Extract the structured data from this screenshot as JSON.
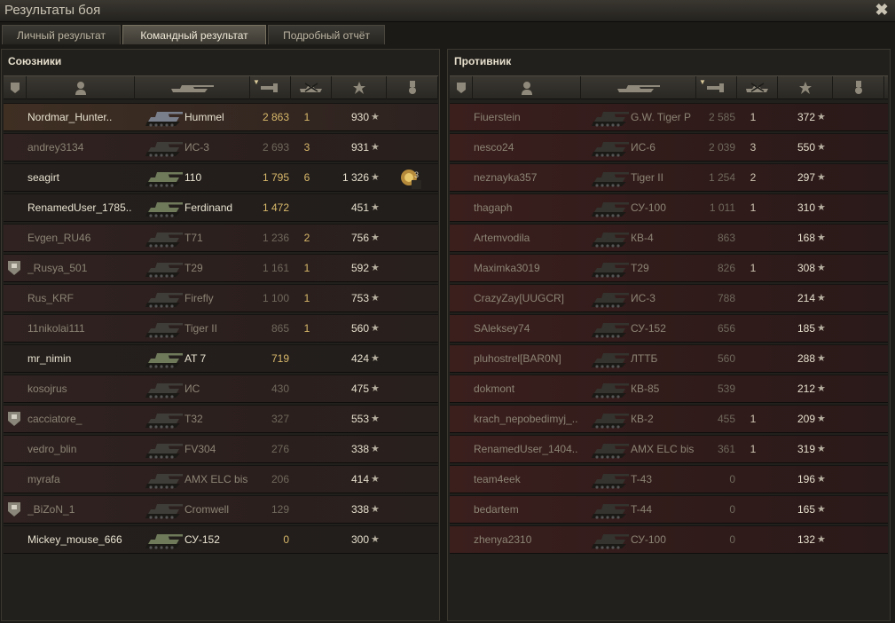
{
  "window": {
    "title": "Результаты боя"
  },
  "tabs": [
    "Личный результат",
    "Командный результат",
    "Подробный отчёт"
  ],
  "active_tab": 1,
  "allies": {
    "title": "Союзники",
    "rows": [
      {
        "name": "Nordmar_Hunter..",
        "tank": "Hummel",
        "damage": "2 863",
        "kills": "1",
        "xp": "930",
        "alive": true,
        "me": true
      },
      {
        "name": "andrey3134",
        "tank": "ИС-3",
        "damage": "2 693",
        "kills": "3",
        "xp": "931",
        "alive": false
      },
      {
        "name": "seagirt",
        "tank": "110",
        "damage": "1 795",
        "kills": "6",
        "xp": "1 326",
        "alive": true,
        "medal": "3"
      },
      {
        "name": "RenamedUser_1785..",
        "tank": "Ferdinand",
        "damage": "1 472",
        "kills": "",
        "xp": "451",
        "alive": true
      },
      {
        "name": "Evgen_RU46",
        "tank": "T71",
        "damage": "1 236",
        "kills": "2",
        "xp": "756",
        "alive": false
      },
      {
        "name": "_Rusya_501",
        "tank": "T29",
        "damage": "1 161",
        "kills": "1",
        "xp": "592",
        "alive": false,
        "platoon": true
      },
      {
        "name": "Rus_KRF",
        "tank": "Firefly",
        "damage": "1 100",
        "kills": "1",
        "xp": "753",
        "alive": false
      },
      {
        "name": "11nikolai111",
        "tank": "Tiger II",
        "damage": "865",
        "kills": "1",
        "xp": "560",
        "alive": false
      },
      {
        "name": "mr_nimin",
        "tank": "AT 7",
        "damage": "719",
        "kills": "",
        "xp": "424",
        "alive": true
      },
      {
        "name": "kosojrus",
        "tank": "ИС",
        "damage": "430",
        "kills": "",
        "xp": "475",
        "alive": false
      },
      {
        "name": "cacciatore_",
        "tank": "T32",
        "damage": "327",
        "kills": "",
        "xp": "553",
        "alive": false,
        "platoon": true
      },
      {
        "name": "vedro_blin",
        "tank": "FV304",
        "damage": "276",
        "kills": "",
        "xp": "338",
        "alive": false
      },
      {
        "name": "myrafa",
        "tank": "AMX ELC bis",
        "damage": "206",
        "kills": "",
        "xp": "414",
        "alive": false
      },
      {
        "name": "_BiZoN_1",
        "tank": "Cromwell",
        "damage": "129",
        "kills": "",
        "xp": "338",
        "alive": false,
        "platoon": true
      },
      {
        "name": "Mickey_mouse_666",
        "tank": "СУ-152",
        "damage": "0",
        "kills": "",
        "xp": "300",
        "alive": true
      }
    ]
  },
  "enemies": {
    "title": "Противник",
    "rows": [
      {
        "name": "Fiuerstein",
        "tank": "G.W. Tiger P",
        "damage": "2 585",
        "kills": "1",
        "xp": "372"
      },
      {
        "name": "nesco24",
        "tank": "ИС-6",
        "damage": "2 039",
        "kills": "3",
        "xp": "550"
      },
      {
        "name": "neznayka357",
        "tank": "Tiger II",
        "damage": "1 254",
        "kills": "2",
        "xp": "297"
      },
      {
        "name": "thagaph",
        "tank": "СУ-100",
        "damage": "1 011",
        "kills": "1",
        "xp": "310"
      },
      {
        "name": "Artemvodila",
        "tank": "КВ-4",
        "damage": "863",
        "kills": "",
        "xp": "168"
      },
      {
        "name": "Maximka3019",
        "tank": "T29",
        "damage": "826",
        "kills": "1",
        "xp": "308"
      },
      {
        "name": "CrazyZay[UUGCR]",
        "tank": "ИС-3",
        "damage": "788",
        "kills": "",
        "xp": "214"
      },
      {
        "name": "SAleksey74",
        "tank": "СУ-152",
        "damage": "656",
        "kills": "",
        "xp": "185"
      },
      {
        "name": "pluhostrel[BAR0N]",
        "tank": "ЛТТБ",
        "damage": "560",
        "kills": "",
        "xp": "288"
      },
      {
        "name": "dokmont",
        "tank": "КВ-85",
        "damage": "539",
        "kills": "",
        "xp": "212"
      },
      {
        "name": "krach_nepobedimyj_..",
        "tank": "КВ-2",
        "damage": "455",
        "kills": "1",
        "xp": "209"
      },
      {
        "name": "RenamedUser_1404..",
        "tank": "AMX ELC bis",
        "damage": "361",
        "kills": "1",
        "xp": "319"
      },
      {
        "name": "team4eek",
        "tank": "T-43",
        "damage": "0",
        "kills": "",
        "xp": "196"
      },
      {
        "name": "bedartem",
        "tank": "T-44",
        "damage": "0",
        "kills": "",
        "xp": "165"
      },
      {
        "name": "zhenya2310",
        "tank": "СУ-100",
        "damage": "0",
        "kills": "",
        "xp": "132"
      }
    ]
  },
  "icons": {
    "star": "★",
    "close": "✖"
  },
  "colors": {
    "ally_bg": "#2b1f1d",
    "enemy_bg": "#331c1b",
    "damage_highlight": "#d8b86a"
  }
}
